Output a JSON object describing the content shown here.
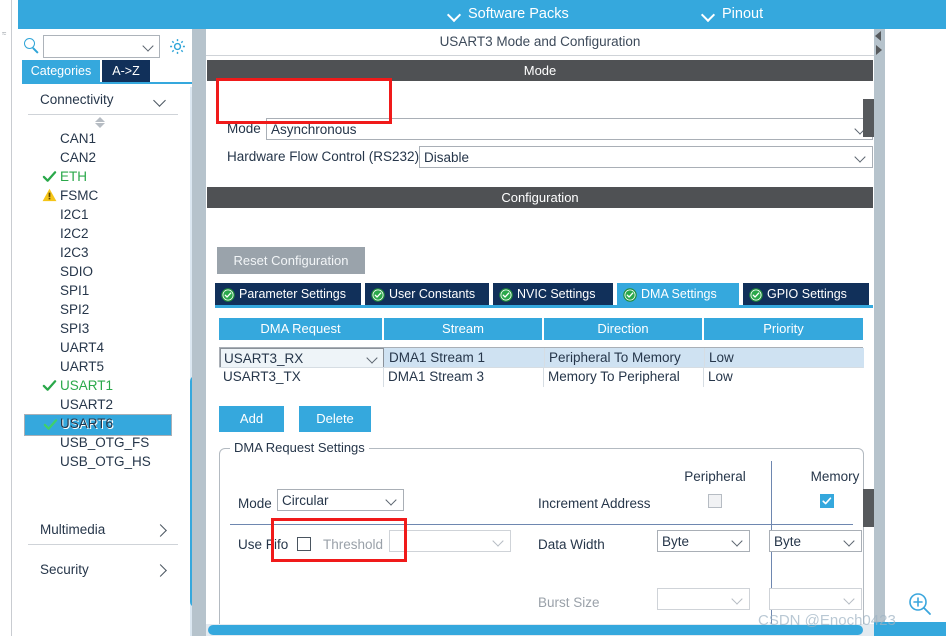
{
  "topbar": {
    "software_packs": "Software Packs",
    "pinout": "Pinout",
    "chevron_icon": "chevron-down-icon",
    "bg_color": "#35a8dd"
  },
  "sidebar": {
    "search": {
      "value": "",
      "placeholder": "",
      "icon": "search-icon"
    },
    "settings_icon": "gear-icon",
    "tabs": [
      {
        "label": "Categories",
        "active": true
      },
      {
        "label": "A->Z",
        "active": false
      }
    ],
    "groups": [
      {
        "label": "Connectivity",
        "expanded": true,
        "caret": "chevron-down-icon"
      },
      {
        "label": "Multimedia",
        "expanded": false,
        "caret": "chevron-right-icon"
      },
      {
        "label": "Security",
        "expanded": false,
        "caret": "chevron-right-icon"
      }
    ],
    "items": [
      {
        "label": "CAN1",
        "status": "none"
      },
      {
        "label": "CAN2",
        "status": "none"
      },
      {
        "label": "ETH",
        "status": "ok"
      },
      {
        "label": "FSMC",
        "status": "warning"
      },
      {
        "label": "I2C1",
        "status": "none"
      },
      {
        "label": "I2C2",
        "status": "none"
      },
      {
        "label": "I2C3",
        "status": "none"
      },
      {
        "label": "SDIO",
        "status": "none"
      },
      {
        "label": "SPI1",
        "status": "none"
      },
      {
        "label": "SPI2",
        "status": "none"
      },
      {
        "label": "SPI3",
        "status": "none"
      },
      {
        "label": "UART4",
        "status": "none"
      },
      {
        "label": "UART5",
        "status": "none"
      },
      {
        "label": "USART1",
        "status": "ok"
      },
      {
        "label": "USART2",
        "status": "none"
      },
      {
        "label": "USART3",
        "status": "ok",
        "selected": true
      },
      {
        "label": "USART6",
        "status": "none"
      },
      {
        "label": "USB_OTG_FS",
        "status": "none"
      },
      {
        "label": "USB_OTG_HS",
        "status": "none"
      }
    ]
  },
  "main": {
    "panel_title": "USART3 Mode and Configuration",
    "mode_section": {
      "header": "Mode",
      "fields": [
        {
          "label": "Mode",
          "value": "Asynchronous",
          "highlighted": true
        },
        {
          "label": "Hardware Flow Control (RS232)",
          "value": "Disable",
          "highlighted": false
        }
      ]
    },
    "config_section": {
      "header": "Configuration",
      "reset_button": "Reset Configuration",
      "tabs": [
        {
          "label": "Parameter Settings",
          "active": false,
          "icon": "check-circle-icon"
        },
        {
          "label": "User Constants",
          "active": false,
          "icon": "check-circle-icon"
        },
        {
          "label": "NVIC Settings",
          "active": false,
          "icon": "check-circle-icon"
        },
        {
          "label": "DMA Settings",
          "active": true,
          "icon": "check-circle-icon"
        },
        {
          "label": "GPIO Settings",
          "active": false,
          "icon": "check-circle-icon"
        }
      ],
      "dma_table": {
        "columns": [
          "DMA Request",
          "Stream",
          "Direction",
          "Priority"
        ],
        "rows": [
          {
            "request": "USART3_RX",
            "stream": "DMA1 Stream 1",
            "direction": "Peripheral To Memory",
            "priority": "Low",
            "selected": true
          },
          {
            "request": "USART3_TX",
            "stream": "DMA1 Stream 3",
            "direction": "Memory To Peripheral",
            "priority": "Low",
            "selected": false
          }
        ]
      },
      "buttons": {
        "add": "Add",
        "delete": "Delete"
      },
      "request_settings": {
        "legend": "DMA Request Settings",
        "col_peripheral": "Peripheral",
        "col_memory": "Memory",
        "mode_label": "Mode",
        "mode_value": "Circular",
        "mode_highlighted": true,
        "increment_label": "Increment Address",
        "increment_peripheral_checked": false,
        "increment_memory_checked": true,
        "use_fifo_label": "Use Fifo",
        "use_fifo_checked": false,
        "threshold_label": "Threshold",
        "threshold_value": "",
        "data_width_label": "Data Width",
        "data_width_peripheral": "Byte",
        "data_width_memory": "Byte",
        "burst_size_label": "Burst Size",
        "burst_size_peripheral": "",
        "burst_size_memory": ""
      }
    }
  },
  "watermark": {
    "text": "CSDN @Enoch0423"
  },
  "zoom_control": {
    "icon": "zoom-in-icon"
  },
  "colors": {
    "accent": "#35a8dd",
    "tab_inactive": "#11305a",
    "section_header": "#4f5154",
    "ok_green": "#2aa84a",
    "warn_yellow": "#f5c518",
    "highlight_red": "#f01a1a"
  }
}
